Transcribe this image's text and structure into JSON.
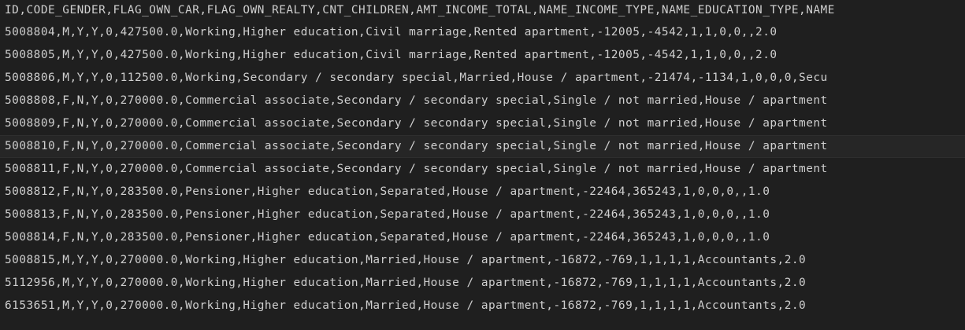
{
  "editor": {
    "current_line": 6,
    "lines": [
      "ID,CODE_GENDER,FLAG_OWN_CAR,FLAG_OWN_REALTY,CNT_CHILDREN,AMT_INCOME_TOTAL,NAME_INCOME_TYPE,NAME_EDUCATION_TYPE,NAME",
      "5008804,M,Y,Y,0,427500.0,Working,Higher education,Civil marriage,Rented apartment,-12005,-4542,1,1,0,0,,2.0",
      "5008805,M,Y,Y,0,427500.0,Working,Higher education,Civil marriage,Rented apartment,-12005,-4542,1,1,0,0,,2.0",
      "5008806,M,Y,Y,0,112500.0,Working,Secondary / secondary special,Married,House / apartment,-21474,-1134,1,0,0,0,Secu",
      "5008808,F,N,Y,0,270000.0,Commercial associate,Secondary / secondary special,Single / not married,House / apartment",
      "5008809,F,N,Y,0,270000.0,Commercial associate,Secondary / secondary special,Single / not married,House / apartment",
      "5008810,F,N,Y,0,270000.0,Commercial associate,Secondary / secondary special,Single / not married,House / apartment",
      "5008811,F,N,Y,0,270000.0,Commercial associate,Secondary / secondary special,Single / not married,House / apartment",
      "5008812,F,N,Y,0,283500.0,Pensioner,Higher education,Separated,House / apartment,-22464,365243,1,0,0,0,,1.0",
      "5008813,F,N,Y,0,283500.0,Pensioner,Higher education,Separated,House / apartment,-22464,365243,1,0,0,0,,1.0",
      "5008814,F,N,Y,0,283500.0,Pensioner,Higher education,Separated,House / apartment,-22464,365243,1,0,0,0,,1.0",
      "5008815,M,Y,Y,0,270000.0,Working,Higher education,Married,House / apartment,-16872,-769,1,1,1,1,Accountants,2.0",
      "5112956,M,Y,Y,0,270000.0,Working,Higher education,Married,House / apartment,-16872,-769,1,1,1,1,Accountants,2.0",
      "6153651,M,Y,Y,0,270000.0,Working,Higher education,Married,House / apartment,-16872,-769,1,1,1,1,Accountants,2.0"
    ]
  }
}
